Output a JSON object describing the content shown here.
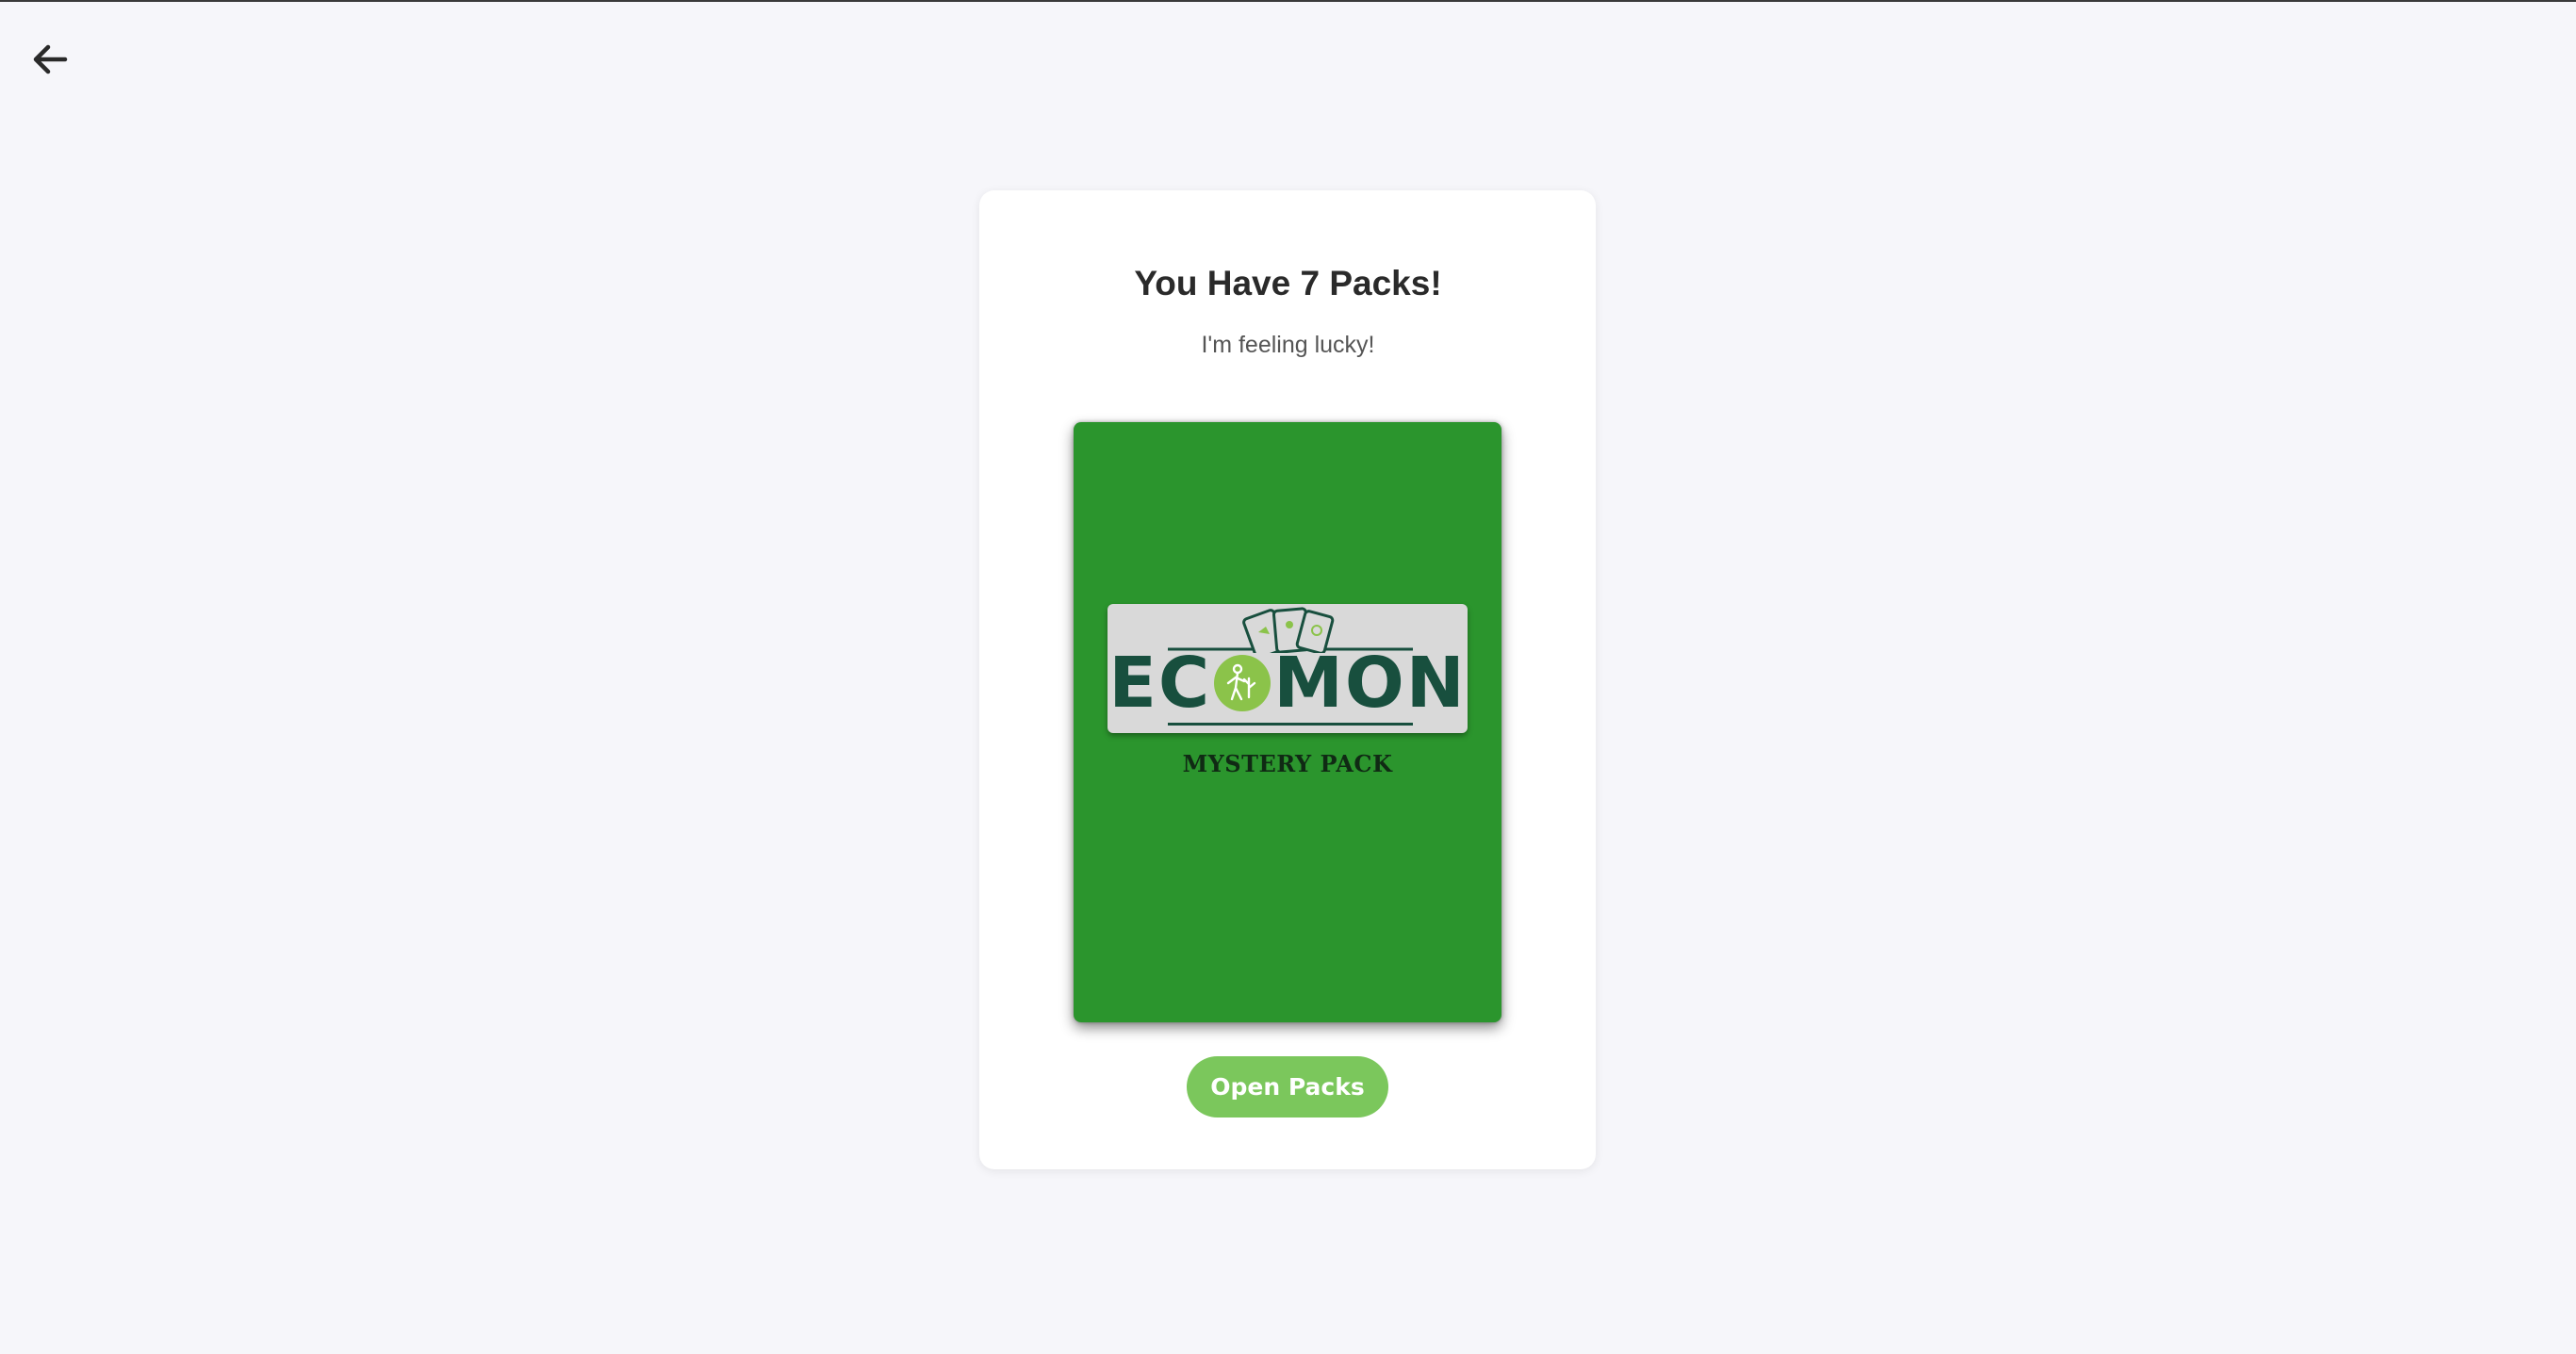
{
  "nav": {
    "back_icon": "arrow-left-icon"
  },
  "packs": {
    "title": "You Have 7 Packs!",
    "subtitle": "I'm feeling lucky!",
    "pack_logo_text_left": "EC",
    "pack_logo_text_right": "MON",
    "pack_label": "MYSTERY PACK",
    "pack_color": "#2b952d",
    "logo_color": "#184f3e",
    "logo_accent": "#8bc34a"
  },
  "actions": {
    "open_label": "Open Packs",
    "open_color": "#7bc75c"
  }
}
